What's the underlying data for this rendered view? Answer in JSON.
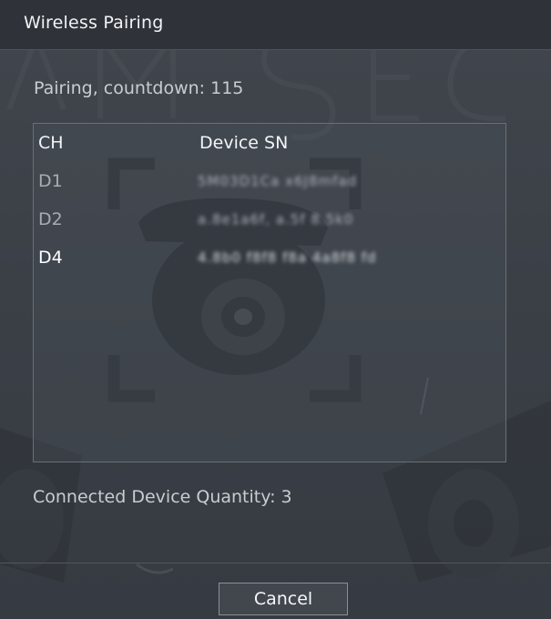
{
  "dialog": {
    "title": "Wireless Pairing",
    "countdown_text": "Pairing, countdown: 115",
    "table": {
      "columns": [
        "CH",
        "Device SN"
      ],
      "rows": [
        {
          "ch": "D1",
          "sn": "5M03D1Ca x6J8mfad",
          "active": false
        },
        {
          "ch": "D2",
          "sn": "a.8e1a6f, a.5f 8.5k0",
          "active": false
        },
        {
          "ch": "D4",
          "sn": "4.8b0 f8f8 f8a 4a8f8 fd",
          "active": true
        }
      ]
    },
    "connected_text": "Connected Device Quantity: 3",
    "cancel_label": "Cancel"
  },
  "colors": {
    "background": "#3b4047",
    "title_bar": "#2f3339",
    "text_primary": "#f3f4f6",
    "text_muted": "#a8acb2"
  }
}
